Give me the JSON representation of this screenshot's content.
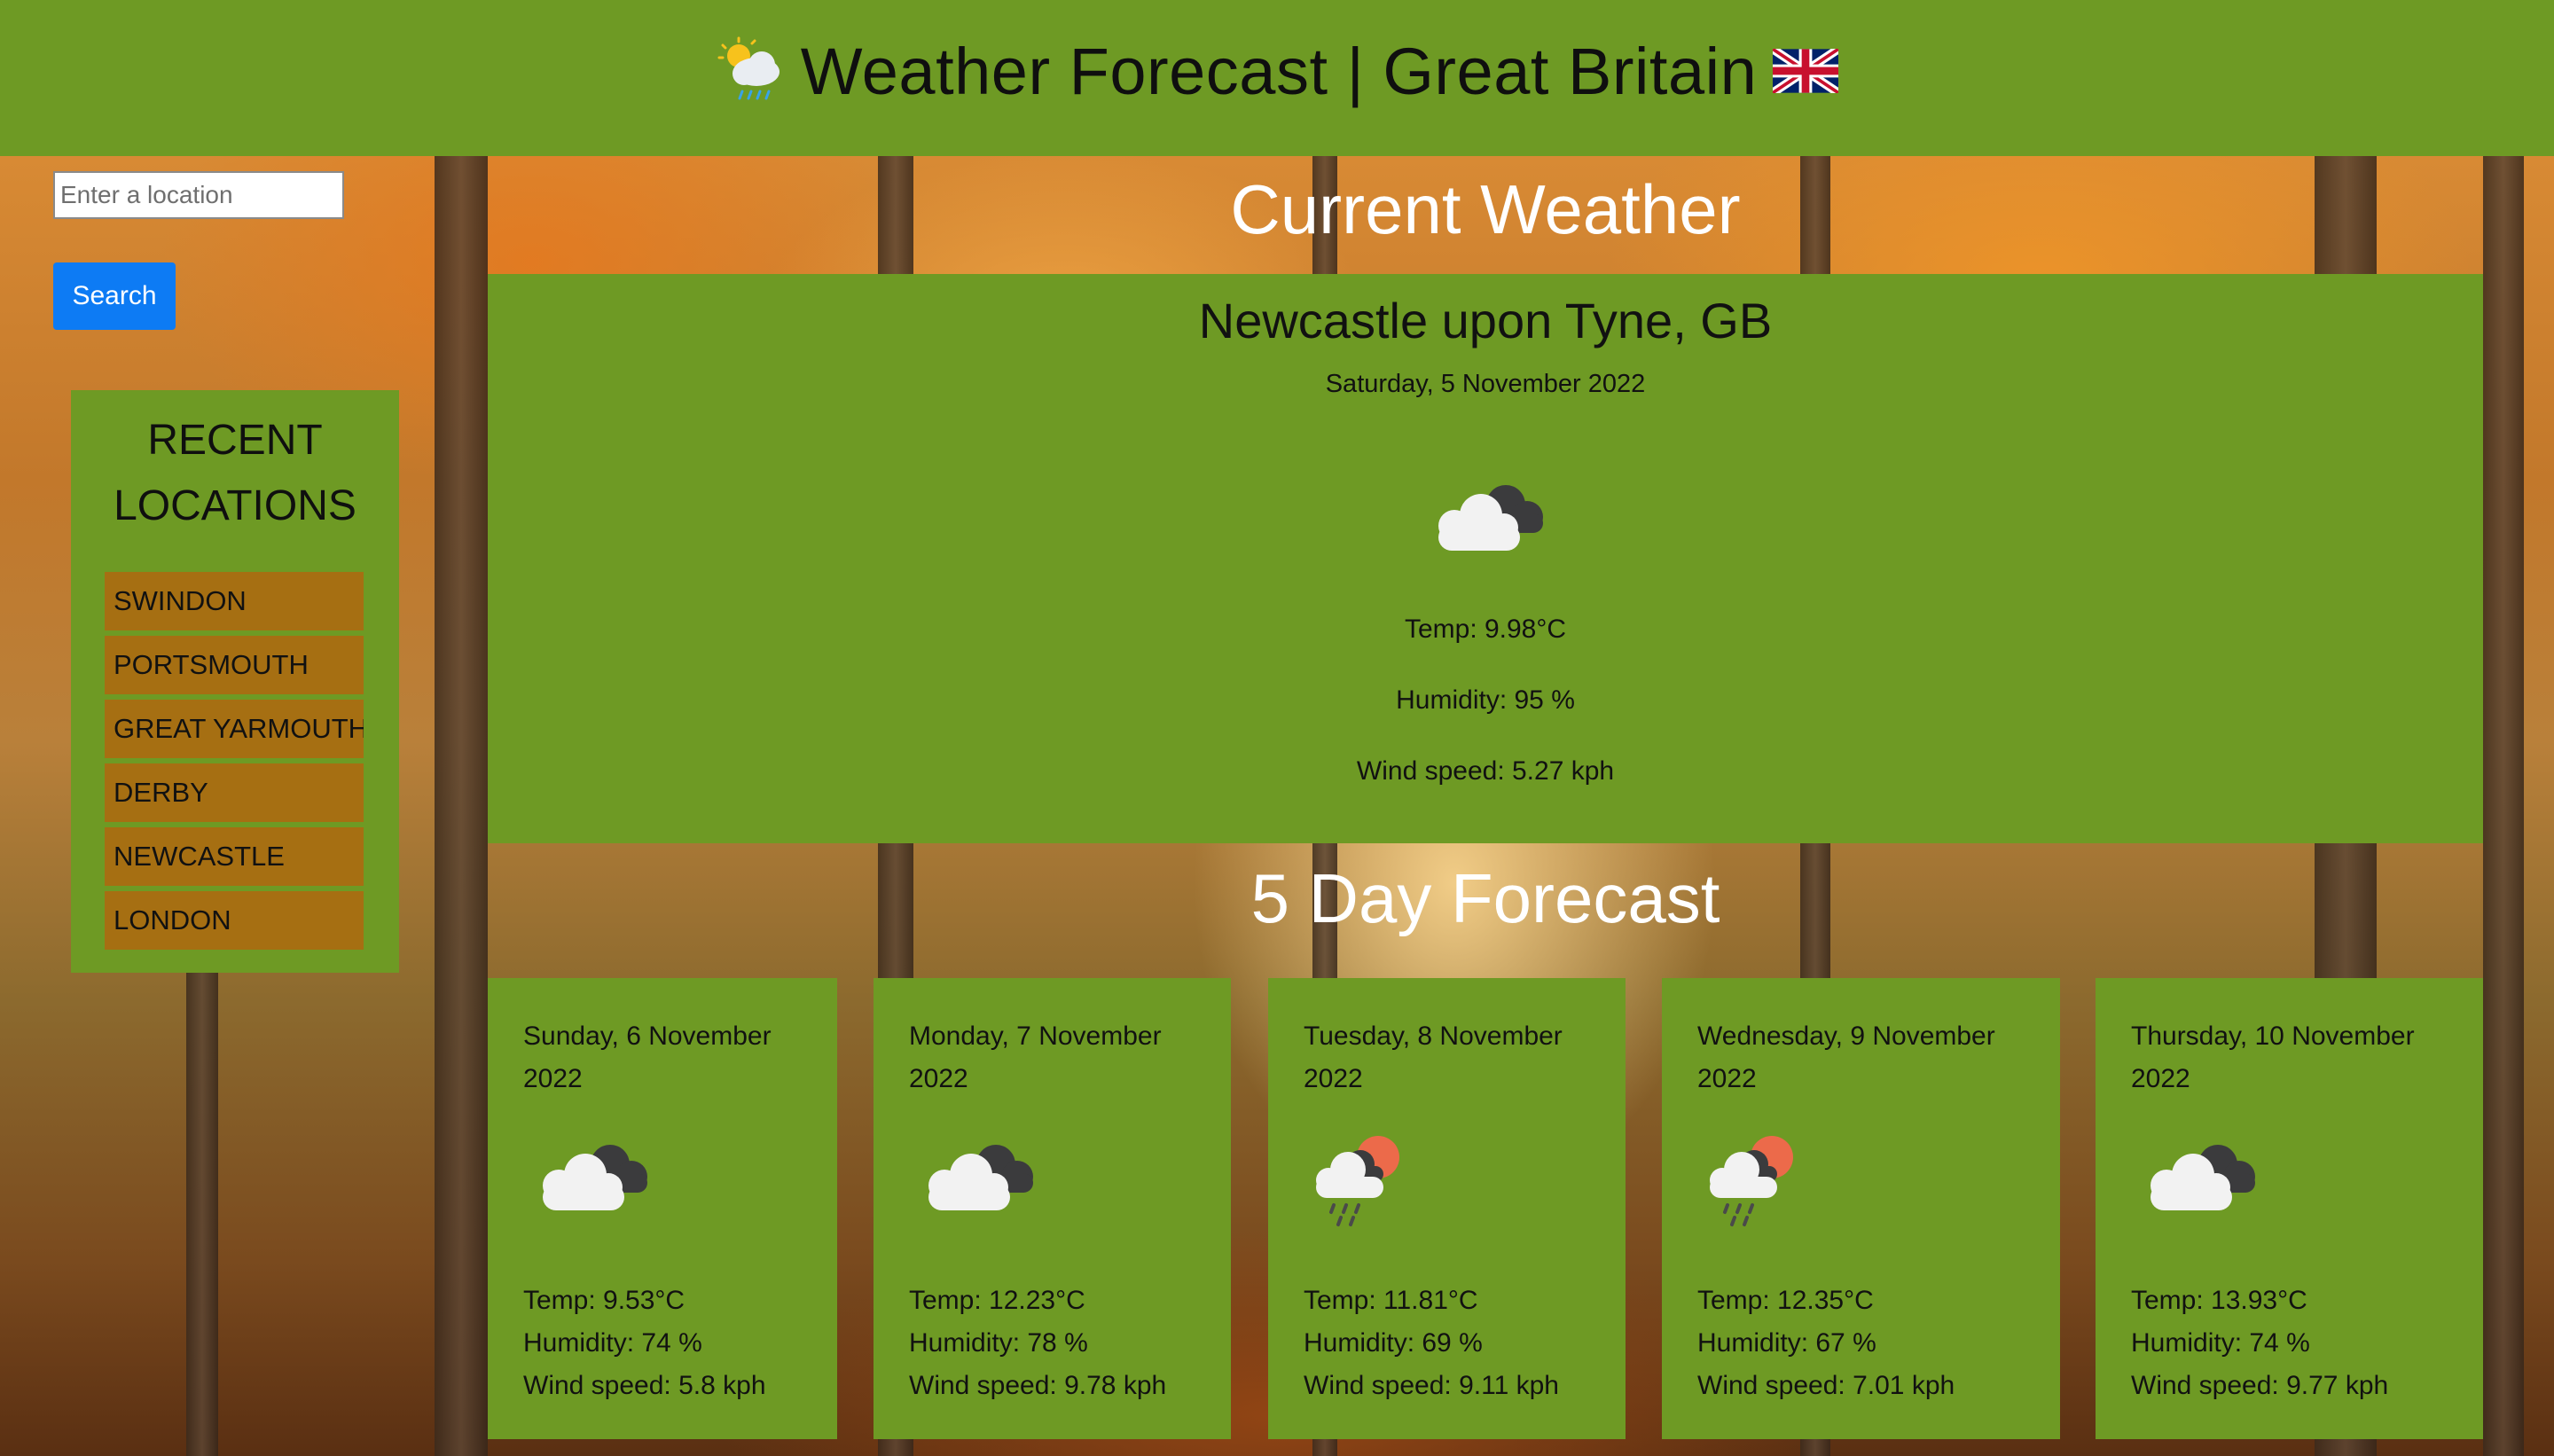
{
  "header": {
    "title": "Weather Forecast | Great Britain",
    "icon": "sun-behind-rain-cloud-icon",
    "flag": "uk-flag-icon"
  },
  "search": {
    "placeholder": "Enter a location",
    "value": "",
    "button_label": "Search"
  },
  "recent": {
    "title": "RECENT LOCATIONS",
    "items": [
      "SWINDON",
      "PORTSMOUTH",
      "GREAT YARMOUTH",
      "DERBY",
      "NEWCASTLE",
      "LONDON"
    ]
  },
  "current": {
    "heading": "Current Weather",
    "city": "Newcastle upon Tyne, GB",
    "date": "Saturday, 5 November 2022",
    "icon": "broken-clouds-icon",
    "temp": "Temp: 9.98°C",
    "humidity": "Humidity: 95 %",
    "wind": "Wind speed: 5.27 kph"
  },
  "forecast": {
    "heading": "5 Day Forecast",
    "days": [
      {
        "date": "Sunday, 6 November 2022",
        "icon": "broken-clouds-icon",
        "temp": "Temp: 9.53°C",
        "humidity": "Humidity: 74 %",
        "wind": "Wind speed: 5.8 kph"
      },
      {
        "date": "Monday, 7 November 2022",
        "icon": "broken-clouds-icon",
        "temp": "Temp: 12.23°C",
        "humidity": "Humidity: 78 %",
        "wind": "Wind speed: 9.78 kph"
      },
      {
        "date": "Tuesday, 8 November 2022",
        "icon": "sun-rain-icon",
        "temp": "Temp: 11.81°C",
        "humidity": "Humidity: 69 %",
        "wind": "Wind speed: 9.11 kph"
      },
      {
        "date": "Wednesday, 9 November 2022",
        "icon": "sun-rain-icon",
        "temp": "Temp: 12.35°C",
        "humidity": "Humidity: 67 %",
        "wind": "Wind speed: 7.01 kph"
      },
      {
        "date": "Thursday, 10 November 2022",
        "icon": "broken-clouds-icon",
        "temp": "Temp: 13.93°C",
        "humidity": "Humidity: 74 %",
        "wind": "Wind speed: 9.77 kph"
      }
    ]
  },
  "colors": {
    "panel_green": "#6e9a24",
    "location_button": "#a66f12",
    "search_button": "#0d7bf4"
  }
}
